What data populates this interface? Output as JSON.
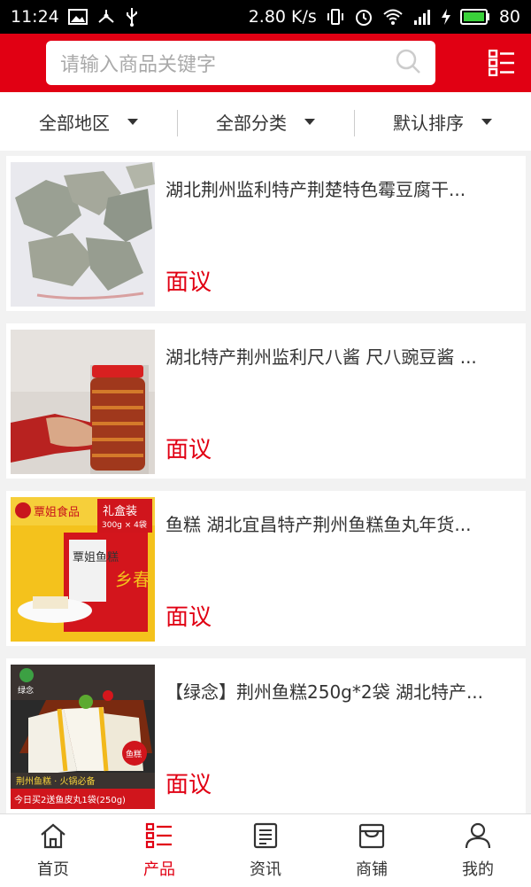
{
  "statusbar": {
    "time": "11:24",
    "speed": "2.80 K/s",
    "battery": "80",
    "left_icons": [
      "image-icon",
      "usb-hub-icon",
      "usb-icon"
    ],
    "right_icons": [
      "vibrate-icon",
      "alarm-icon",
      "wifi-icon",
      "signal-icon",
      "charging-icon",
      "battery-icon"
    ]
  },
  "header": {
    "search_placeholder": "请输入商品关键字",
    "accent": "#e10013"
  },
  "filters": [
    {
      "label": "全部地区"
    },
    {
      "label": "全部分类"
    },
    {
      "label": "默认排序"
    }
  ],
  "products": [
    {
      "title": "湖北荆州监利特产荆楚特色霉豆腐干...",
      "price": "面议"
    },
    {
      "title": "湖北特产荆州监利尺八酱 尺八豌豆酱 ...",
      "price": "面议"
    },
    {
      "title": "鱼糕 湖北宜昌特产荆州鱼糕鱼丸年货...",
      "price": "面议"
    },
    {
      "title": "【绿念】荆州鱼糕250g*2袋 湖北特产...",
      "price": "面议"
    }
  ],
  "thumb_text": {
    "p3_brand": "覃姐食品",
    "p3_giftbox": "礼盒装",
    "p3_spec": "300g × 4袋",
    "p3_bag": "覃姐鱼糕",
    "p3_side": "乡春",
    "p4_brand": "绿念",
    "p4_tag": "荆州鱼糕 · 火锅必备",
    "p4_promo": "今日买2送鱼皮丸1袋(250g)",
    "p4_badge": "鱼糕"
  },
  "bottomnav": [
    {
      "label": "首页",
      "icon": "home-icon",
      "active": false
    },
    {
      "label": "产品",
      "icon": "product-list-icon",
      "active": true
    },
    {
      "label": "资讯",
      "icon": "news-icon",
      "active": false
    },
    {
      "label": "商铺",
      "icon": "store-icon",
      "active": false
    },
    {
      "label": "我的",
      "icon": "user-icon",
      "active": false
    }
  ]
}
